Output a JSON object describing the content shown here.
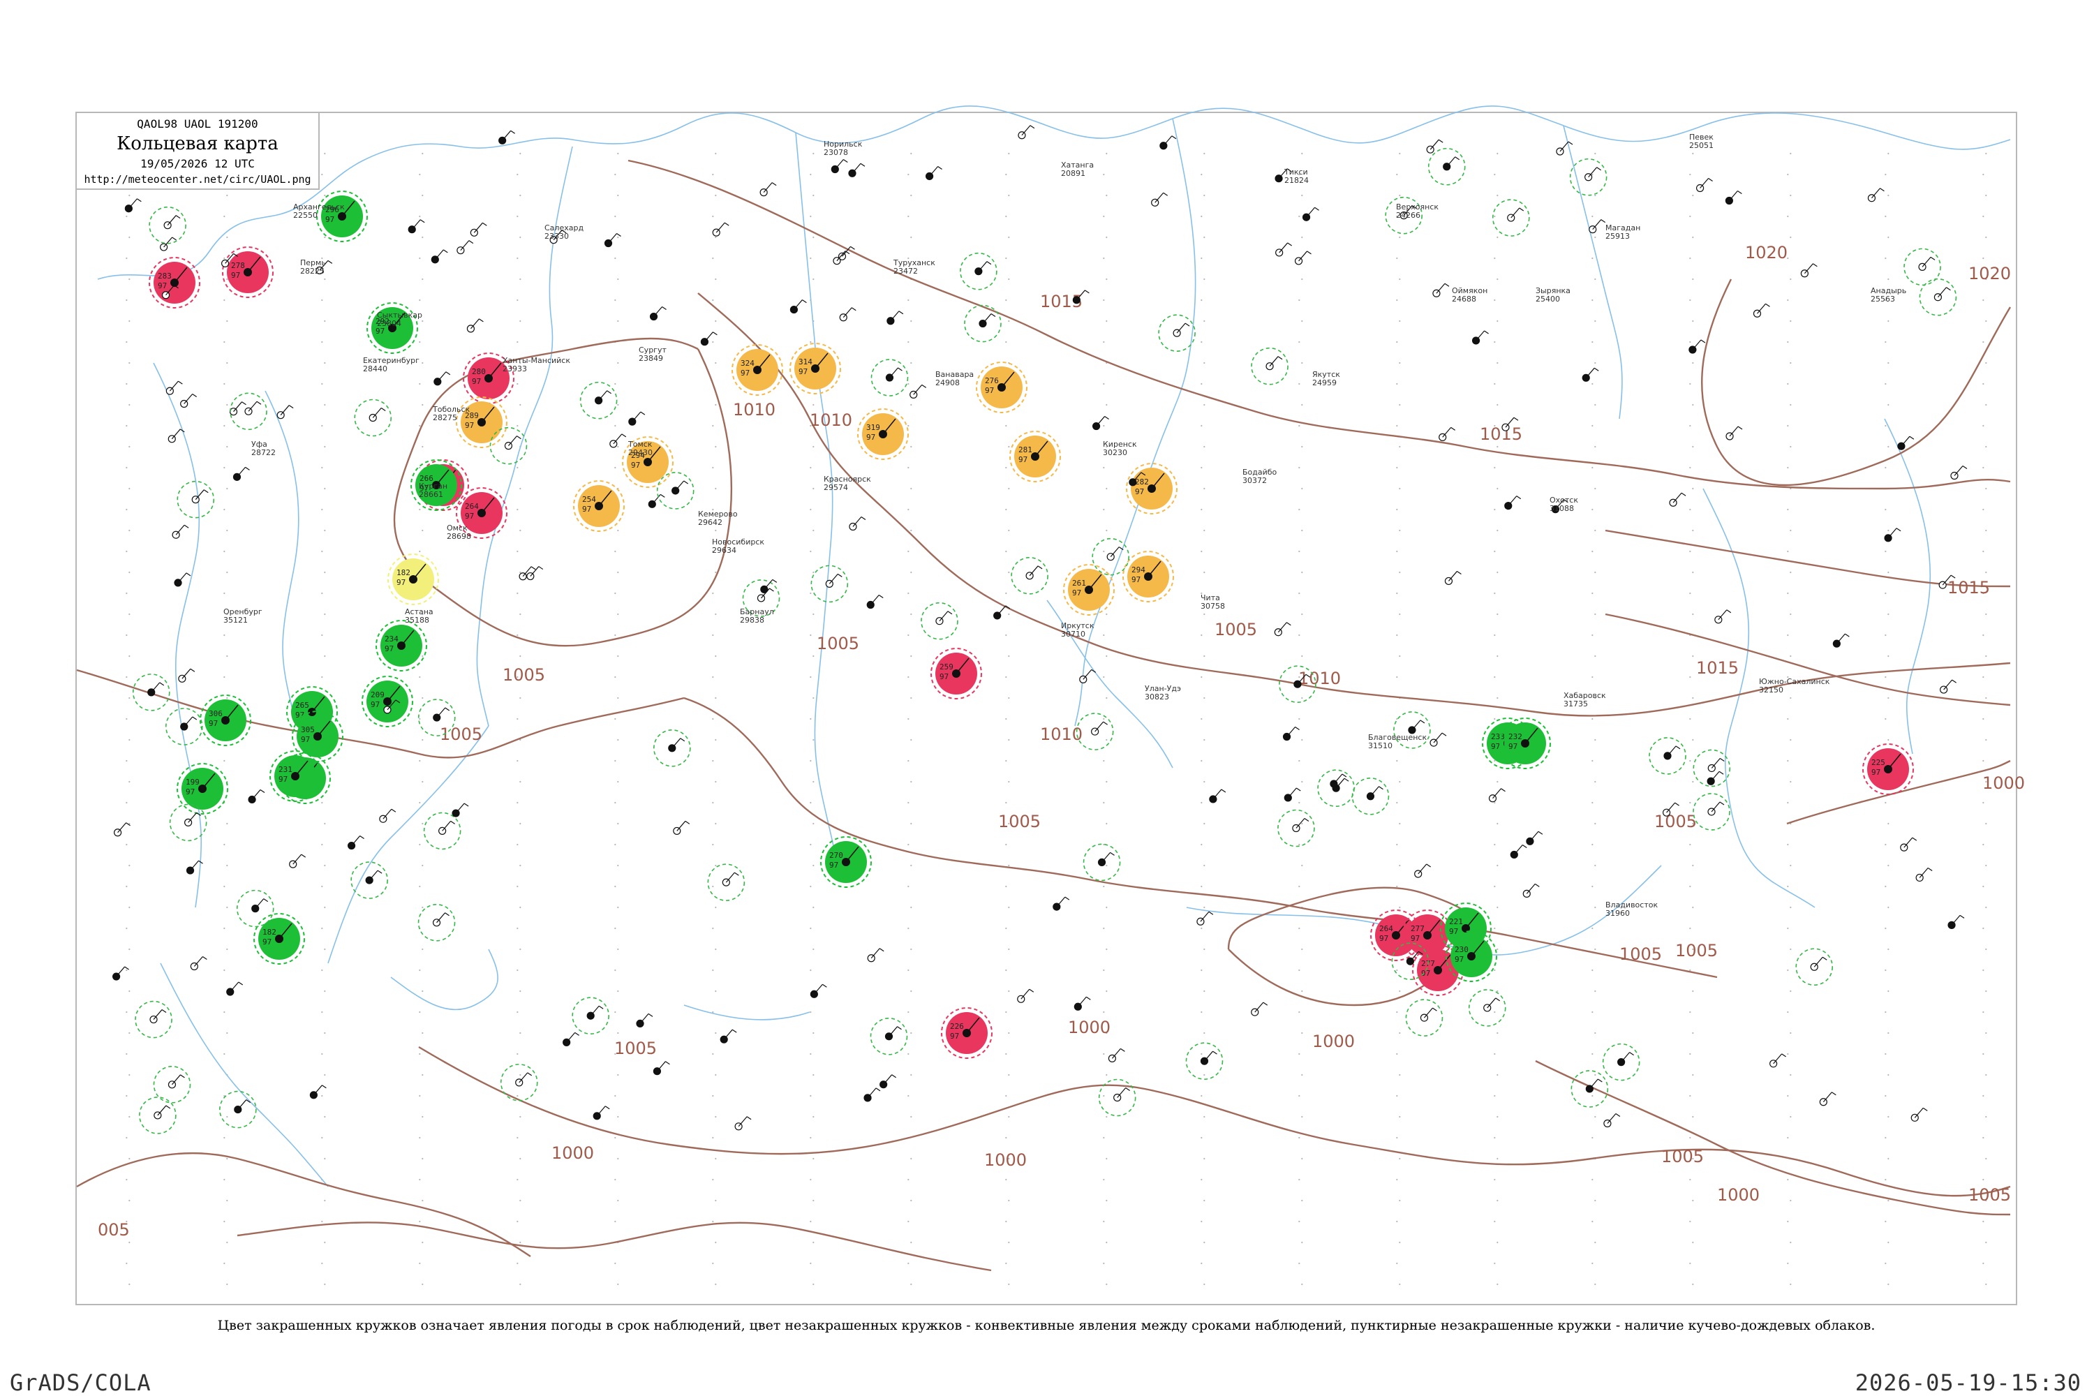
{
  "title": {
    "code": "QAOL98  UAOL  191200",
    "name": "Кольцевая карта",
    "datetime": "19/05/2026 12 UTC",
    "url": "http://meteocenter.net/circ/UAOL.png"
  },
  "legend_note": "Цвет закрашенных кружков означает явления погоды в срок наблюдений, цвет незакрашенных кружков - конвективные явления между сроками наблюдений, пунктирные незакрашенные кружки - наличие кучево-дождевых облаков.",
  "footer": {
    "left": "GrADS/COLA",
    "right": "2026-05-19-15:30"
  },
  "colors": {
    "isobar": "#a06a5a",
    "water": "#86c0ea",
    "thunder": "#e8365f",
    "rain": "#1cbf35",
    "fog": "#f5b94a",
    "drizzle": "#f2f07a",
    "cb_dashed": "#34b846",
    "grid_dot": "#b5b5b5"
  },
  "isobar_labels": [
    "1015",
    "1015",
    "1010",
    "1020",
    "1020",
    "1015",
    "1015",
    "1010",
    "1005",
    "1005",
    "1005",
    "1005",
    "1010",
    "1005",
    "1005",
    "1000",
    "1005",
    "1000",
    "1000",
    "1000",
    "1005",
    "1000",
    "1005",
    "1005",
    "1000",
    "1005",
    "005",
    "1010"
  ],
  "stations": [
    {
      "kind": "thunder",
      "pres": "283",
      "dew": "97"
    },
    {
      "kind": "thunder",
      "pres": "278",
      "dew": "97"
    },
    {
      "kind": "thunder",
      "pres": "280",
      "dew": "97"
    },
    {
      "kind": "thunder",
      "pres": "261",
      "dew": "97"
    },
    {
      "kind": "thunder",
      "pres": "264",
      "dew": "97"
    },
    {
      "kind": "thunder",
      "pres": "259",
      "dew": "97"
    },
    {
      "kind": "thunder",
      "pres": "226",
      "dew": "97"
    },
    {
      "kind": "thunder",
      "pres": "264",
      "dew": "97"
    },
    {
      "kind": "thunder",
      "pres": "277",
      "dew": "97"
    },
    {
      "kind": "thunder",
      "pres": "277",
      "dew": "97"
    },
    {
      "kind": "thunder",
      "pres": "225",
      "dew": "97"
    },
    {
      "kind": "rain",
      "pres": "296",
      "dew": "97"
    },
    {
      "kind": "rain",
      "pres": "292",
      "dew": "97"
    },
    {
      "kind": "rain",
      "pres": "266",
      "dew": "97"
    },
    {
      "kind": "rain",
      "pres": "234",
      "dew": "97"
    },
    {
      "kind": "rain",
      "pres": "265",
      "dew": "97"
    },
    {
      "kind": "rain",
      "pres": "209",
      "dew": "97"
    },
    {
      "kind": "rain",
      "pres": "305",
      "dew": "97"
    },
    {
      "kind": "rain",
      "pres": "306",
      "dew": "97"
    },
    {
      "kind": "rain",
      "pres": "208",
      "dew": "97"
    },
    {
      "kind": "rain",
      "pres": "199",
      "dew": "97"
    },
    {
      "kind": "rain",
      "pres": "231",
      "dew": "97"
    },
    {
      "kind": "rain",
      "pres": "182",
      "dew": "97"
    },
    {
      "kind": "rain",
      "pres": "270",
      "dew": "97"
    },
    {
      "kind": "rain",
      "pres": "221",
      "dew": "97"
    },
    {
      "kind": "rain",
      "pres": "230",
      "dew": "97"
    },
    {
      "kind": "rain",
      "pres": "233",
      "dew": "97"
    },
    {
      "kind": "rain",
      "pres": "232",
      "dew": "97"
    },
    {
      "kind": "fog",
      "pres": "289",
      "dew": "97"
    },
    {
      "kind": "fog",
      "pres": "324",
      "dew": "97"
    },
    {
      "kind": "fog",
      "pres": "314",
      "dew": "97"
    },
    {
      "kind": "fog",
      "pres": "294",
      "dew": "97"
    },
    {
      "kind": "fog",
      "pres": "319",
      "dew": "97"
    },
    {
      "kind": "fog",
      "pres": "276",
      "dew": "97"
    },
    {
      "kind": "fog",
      "pres": "281",
      "dew": "97"
    },
    {
      "kind": "fog",
      "pres": "282",
      "dew": "97"
    },
    {
      "kind": "fog",
      "pres": "294",
      "dew": "97"
    },
    {
      "kind": "fog",
      "pres": "254",
      "dew": "97"
    },
    {
      "kind": "fog",
      "pres": "261",
      "dew": "97"
    },
    {
      "kind": "drizzle",
      "pres": "182",
      "dew": "97"
    }
  ],
  "labelled_stations": [
    {
      "name": "Архангельск",
      "id": "22550"
    },
    {
      "name": "Сыктывкар",
      "id": "23804"
    },
    {
      "name": "Ханты-Мансийск",
      "id": "23933"
    },
    {
      "name": "Салехард",
      "id": "23330"
    },
    {
      "name": "Сургут",
      "id": "23849"
    },
    {
      "name": "Тобольск",
      "id": "28275"
    },
    {
      "name": "Омск",
      "id": "28698"
    },
    {
      "name": "Новосибирск",
      "id": "29634"
    },
    {
      "name": "Томск",
      "id": "29430"
    },
    {
      "name": "Красноярск",
      "id": "29574"
    },
    {
      "name": "Иркутск",
      "id": "30710"
    },
    {
      "name": "Чита",
      "id": "30758"
    },
    {
      "name": "Якутск",
      "id": "24959"
    },
    {
      "name": "Тикси",
      "id": "21824"
    },
    {
      "name": "Магадан",
      "id": "25913"
    },
    {
      "name": "Охотск",
      "id": "31088"
    },
    {
      "name": "Хабаровск",
      "id": "31735"
    },
    {
      "name": "Благовещенск",
      "id": "31510"
    },
    {
      "name": "Владивосток",
      "id": "31960"
    },
    {
      "name": "Южно-Сахалинск",
      "id": "32150"
    },
    {
      "name": "Пермь",
      "id": "28225"
    },
    {
      "name": "Екатеринбург",
      "id": "28440"
    },
    {
      "name": "Уфа",
      "id": "28722"
    },
    {
      "name": "Оренбург",
      "id": "35121"
    },
    {
      "name": "Курган",
      "id": "28661"
    },
    {
      "name": "Астана",
      "id": "35188"
    },
    {
      "name": "Барнаул",
      "id": "29838"
    },
    {
      "name": "Кемерово",
      "id": "29642"
    },
    {
      "name": "Улан-Удэ",
      "id": "30823"
    },
    {
      "name": "Бодайбо",
      "id": "30372"
    },
    {
      "name": "Киренск",
      "id": "30230"
    },
    {
      "name": "Ванавара",
      "id": "24908"
    },
    {
      "name": "Туруханск",
      "id": "23472"
    },
    {
      "name": "Норильск",
      "id": "23078"
    },
    {
      "name": "Хатанга",
      "id": "20891"
    },
    {
      "name": "Оймякон",
      "id": "24688"
    },
    {
      "name": "Верхоянск",
      "id": "24266"
    },
    {
      "name": "Зырянка",
      "id": "25400"
    },
    {
      "name": "Анадырь",
      "id": "25563"
    },
    {
      "name": "Певек",
      "id": "25051"
    }
  ]
}
